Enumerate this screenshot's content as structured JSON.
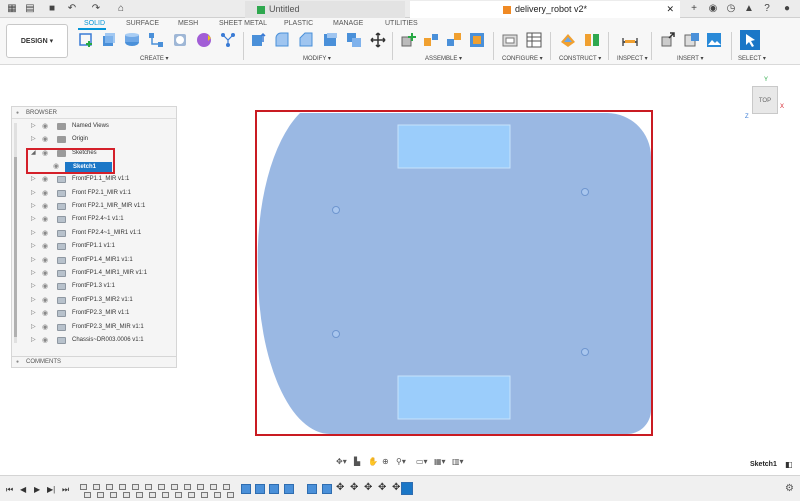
{
  "tabs": {
    "untitled": "Untitled",
    "active": "delivery_robot v2*"
  },
  "toolbar": {
    "design_label": "DESIGN ▾",
    "workspace_tabs": [
      "SOLID",
      "SURFACE",
      "MESH",
      "SHEET METAL",
      "PLASTIC",
      "MANAGE",
      "UTILITIES"
    ],
    "groups": [
      "CREATE ▾",
      "MODIFY ▾",
      "ASSEMBLE ▾",
      "CONFIGURE ▾",
      "CONSTRUCT ▾",
      "INSPECT ▾",
      "INSERT ▾",
      "SELECT ▾"
    ]
  },
  "browser": {
    "title": "BROWSER",
    "items": [
      {
        "label": "Named Views",
        "type": "folder"
      },
      {
        "label": "Origin",
        "type": "folder"
      },
      {
        "label": "Sketches",
        "type": "folder"
      },
      {
        "label": "FrontFP1.1_MIR v1:1",
        "type": "comp"
      },
      {
        "label": "Front FP2.1_MIR v1:1",
        "type": "comp"
      },
      {
        "label": "Front FP2.1_MIR_MIR v1:1",
        "type": "comp"
      },
      {
        "label": "Front FP2.4~1 v1:1",
        "type": "comp"
      },
      {
        "label": "Front FP2.4~1_MIR1 v1:1",
        "type": "comp"
      },
      {
        "label": "FrontFP1.1 v1:1",
        "type": "comp"
      },
      {
        "label": "FrontFP1.4_MIR1 v1:1",
        "type": "comp"
      },
      {
        "label": "FrontFP1.4_MIR1_MIR v1:1",
        "type": "comp"
      },
      {
        "label": "FrontFP1.3 v1:1",
        "type": "comp"
      },
      {
        "label": "FrontFP1.3_MIR2 v1:1",
        "type": "comp"
      },
      {
        "label": "FrontFP2.3_MIR v1:1",
        "type": "comp"
      },
      {
        "label": "FrontFP2.3_MIR_MIR v1:1",
        "type": "comp"
      },
      {
        "label": "Chassis~DR003.0006 v1:1",
        "type": "comp"
      }
    ],
    "selected_sketch": "Sketch1",
    "comments": "COMMENTS"
  },
  "viewcube": {
    "face": "TOP",
    "axis_x": "X",
    "axis_y": "Y",
    "axis_z": "Z"
  },
  "status": {
    "active_sketch": "Sketch1"
  },
  "colors": {
    "accent": "#0696d7",
    "selection": "#1b77c7",
    "highlight": "#d4202a",
    "sketch_fill": "#9ab8e3",
    "sketch_cutout": "#9bcdfb"
  }
}
